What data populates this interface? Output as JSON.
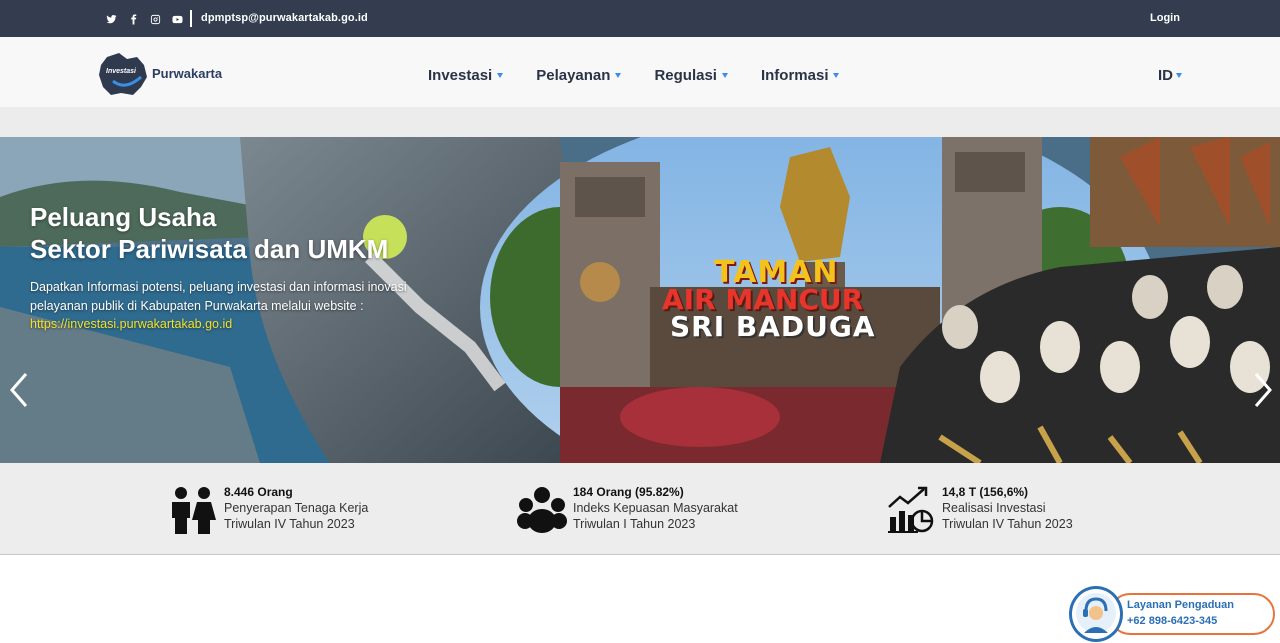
{
  "topbar": {
    "social_icons": [
      "twitter-icon",
      "facebook-icon",
      "instagram-icon",
      "youtube-icon"
    ],
    "email": "dpmptsp@purwakartakab.go.id",
    "login_label": "Login"
  },
  "header": {
    "logo_badge": "Investasi",
    "logo_text": "Purwakarta",
    "nav": [
      {
        "label": "Investasi"
      },
      {
        "label": "Pelayanan"
      },
      {
        "label": "Regulasi"
      },
      {
        "label": "Informasi"
      }
    ],
    "language": "ID"
  },
  "hero": {
    "title_line1": "Peluang Usaha",
    "title_line2": "Sektor Pariwisata dan UMKM",
    "description": "Dapatkan Informasi potensi, peluang investasi dan informasi inovasi pelayanan publik di Kabupaten Purwakarta melalui website :",
    "link": "https://investasi.purwakartakab.go.id",
    "sign_line1": "TAMAN",
    "sign_line2": "AIR MANCUR",
    "sign_line3": "SRI BADUGA"
  },
  "stats": [
    {
      "icon": "people-icon",
      "value": "8.446 Orang",
      "label1": "Penyerapan Tenaga Kerja",
      "label2": "Triwulan IV Tahun 2023"
    },
    {
      "icon": "group-icon",
      "value": "184 Orang (95.82%)",
      "label1": "Indeks Kepuasan Masyarakat",
      "label2": "Triwulan I Tahun 2023"
    },
    {
      "icon": "investment-chart-icon",
      "value": "14,8 T (156,6%)",
      "label1": "Realisasi Investasi",
      "label2": "Triwulan IV Tahun 2023"
    }
  ],
  "complaint": {
    "title": "Layanan Pengaduan",
    "phone": "+62 898-6423-345"
  },
  "colors": {
    "topbar": "#333d4f",
    "accent": "#3a8ee6",
    "link": "#f5e02a",
    "widget_border": "#e8743b",
    "widget_text": "#2b6fb5"
  }
}
